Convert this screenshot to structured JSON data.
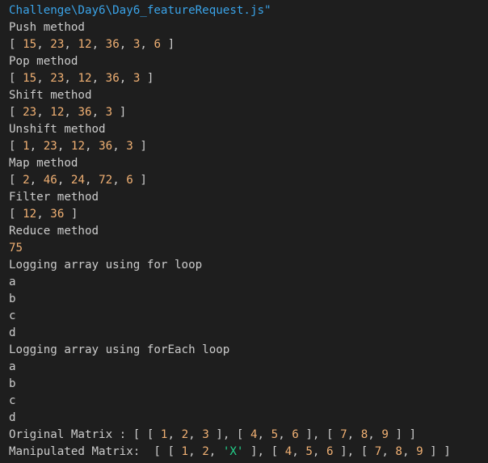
{
  "colors": {
    "background": "#1e1e1e",
    "text": "#cccccc",
    "path": "#3aa3e8",
    "number": "#f0b073",
    "string": "#23d18b"
  },
  "lines": [
    [
      {
        "t": "Challenge\\Day6\\Day6_featureRequest.js\"",
        "c": "path"
      }
    ],
    [
      {
        "t": "Push method",
        "c": "text"
      }
    ],
    [
      {
        "t": "[ ",
        "c": "text"
      },
      {
        "t": "15",
        "c": "num"
      },
      {
        "t": ", ",
        "c": "text"
      },
      {
        "t": "23",
        "c": "num"
      },
      {
        "t": ", ",
        "c": "text"
      },
      {
        "t": "12",
        "c": "num"
      },
      {
        "t": ", ",
        "c": "text"
      },
      {
        "t": "36",
        "c": "num"
      },
      {
        "t": ", ",
        "c": "text"
      },
      {
        "t": "3",
        "c": "num"
      },
      {
        "t": ", ",
        "c": "text"
      },
      {
        "t": "6",
        "c": "num"
      },
      {
        "t": " ]",
        "c": "text"
      }
    ],
    [
      {
        "t": "Pop method",
        "c": "text"
      }
    ],
    [
      {
        "t": "[ ",
        "c": "text"
      },
      {
        "t": "15",
        "c": "num"
      },
      {
        "t": ", ",
        "c": "text"
      },
      {
        "t": "23",
        "c": "num"
      },
      {
        "t": ", ",
        "c": "text"
      },
      {
        "t": "12",
        "c": "num"
      },
      {
        "t": ", ",
        "c": "text"
      },
      {
        "t": "36",
        "c": "num"
      },
      {
        "t": ", ",
        "c": "text"
      },
      {
        "t": "3",
        "c": "num"
      },
      {
        "t": " ]",
        "c": "text"
      }
    ],
    [
      {
        "t": "Shift method",
        "c": "text"
      }
    ],
    [
      {
        "t": "[ ",
        "c": "text"
      },
      {
        "t": "23",
        "c": "num"
      },
      {
        "t": ", ",
        "c": "text"
      },
      {
        "t": "12",
        "c": "num"
      },
      {
        "t": ", ",
        "c": "text"
      },
      {
        "t": "36",
        "c": "num"
      },
      {
        "t": ", ",
        "c": "text"
      },
      {
        "t": "3",
        "c": "num"
      },
      {
        "t": " ]",
        "c": "text"
      }
    ],
    [
      {
        "t": "Unshift method",
        "c": "text"
      }
    ],
    [
      {
        "t": "[ ",
        "c": "text"
      },
      {
        "t": "1",
        "c": "num"
      },
      {
        "t": ", ",
        "c": "text"
      },
      {
        "t": "23",
        "c": "num"
      },
      {
        "t": ", ",
        "c": "text"
      },
      {
        "t": "12",
        "c": "num"
      },
      {
        "t": ", ",
        "c": "text"
      },
      {
        "t": "36",
        "c": "num"
      },
      {
        "t": ", ",
        "c": "text"
      },
      {
        "t": "3",
        "c": "num"
      },
      {
        "t": " ]",
        "c": "text"
      }
    ],
    [
      {
        "t": "Map method",
        "c": "text"
      }
    ],
    [
      {
        "t": "[ ",
        "c": "text"
      },
      {
        "t": "2",
        "c": "num"
      },
      {
        "t": ", ",
        "c": "text"
      },
      {
        "t": "46",
        "c": "num"
      },
      {
        "t": ", ",
        "c": "text"
      },
      {
        "t": "24",
        "c": "num"
      },
      {
        "t": ", ",
        "c": "text"
      },
      {
        "t": "72",
        "c": "num"
      },
      {
        "t": ", ",
        "c": "text"
      },
      {
        "t": "6",
        "c": "num"
      },
      {
        "t": " ]",
        "c": "text"
      }
    ],
    [
      {
        "t": "Filter method",
        "c": "text"
      }
    ],
    [
      {
        "t": "[ ",
        "c": "text"
      },
      {
        "t": "12",
        "c": "num"
      },
      {
        "t": ", ",
        "c": "text"
      },
      {
        "t": "36",
        "c": "num"
      },
      {
        "t": " ]",
        "c": "text"
      }
    ],
    [
      {
        "t": "Reduce method",
        "c": "text"
      }
    ],
    [
      {
        "t": "75",
        "c": "num"
      }
    ],
    [
      {
        "t": "Logging array using for loop",
        "c": "text"
      }
    ],
    [
      {
        "t": "a",
        "c": "text"
      }
    ],
    [
      {
        "t": "b",
        "c": "text"
      }
    ],
    [
      {
        "t": "c",
        "c": "text"
      }
    ],
    [
      {
        "t": "d",
        "c": "text"
      }
    ],
    [
      {
        "t": "Logging array using forEach loop",
        "c": "text"
      }
    ],
    [
      {
        "t": "a",
        "c": "text"
      }
    ],
    [
      {
        "t": "b",
        "c": "text"
      }
    ],
    [
      {
        "t": "c",
        "c": "text"
      }
    ],
    [
      {
        "t": "d",
        "c": "text"
      }
    ],
    [
      {
        "t": "Original Matrix : [ [ ",
        "c": "text"
      },
      {
        "t": "1",
        "c": "num"
      },
      {
        "t": ", ",
        "c": "text"
      },
      {
        "t": "2",
        "c": "num"
      },
      {
        "t": ", ",
        "c": "text"
      },
      {
        "t": "3",
        "c": "num"
      },
      {
        "t": " ], [ ",
        "c": "text"
      },
      {
        "t": "4",
        "c": "num"
      },
      {
        "t": ", ",
        "c": "text"
      },
      {
        "t": "5",
        "c": "num"
      },
      {
        "t": ", ",
        "c": "text"
      },
      {
        "t": "6",
        "c": "num"
      },
      {
        "t": " ], [ ",
        "c": "text"
      },
      {
        "t": "7",
        "c": "num"
      },
      {
        "t": ", ",
        "c": "text"
      },
      {
        "t": "8",
        "c": "num"
      },
      {
        "t": ", ",
        "c": "text"
      },
      {
        "t": "9",
        "c": "num"
      },
      {
        "t": " ] ]",
        "c": "text"
      }
    ],
    [
      {
        "t": "Manipulated Matrix:  [ [ ",
        "c": "text"
      },
      {
        "t": "1",
        "c": "num"
      },
      {
        "t": ", ",
        "c": "text"
      },
      {
        "t": "2",
        "c": "num"
      },
      {
        "t": ", ",
        "c": "text"
      },
      {
        "t": "'X'",
        "c": "str"
      },
      {
        "t": " ], [ ",
        "c": "text"
      },
      {
        "t": "4",
        "c": "num"
      },
      {
        "t": ", ",
        "c": "text"
      },
      {
        "t": "5",
        "c": "num"
      },
      {
        "t": ", ",
        "c": "text"
      },
      {
        "t": "6",
        "c": "num"
      },
      {
        "t": " ], [ ",
        "c": "text"
      },
      {
        "t": "7",
        "c": "num"
      },
      {
        "t": ", ",
        "c": "text"
      },
      {
        "t": "8",
        "c": "num"
      },
      {
        "t": ", ",
        "c": "text"
      },
      {
        "t": "9",
        "c": "num"
      },
      {
        "t": " ] ]",
        "c": "text"
      }
    ]
  ]
}
